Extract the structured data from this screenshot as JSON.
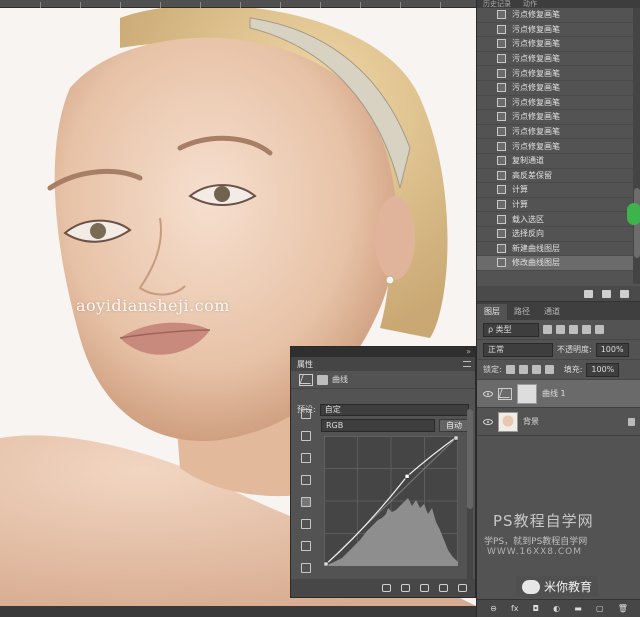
{
  "top_tabs": [
    "历史记录",
    "动作"
  ],
  "history_items": [
    "污点修复画笔",
    "污点修复画笔",
    "污点修复画笔",
    "污点修复画笔",
    "污点修复画笔",
    "污点修复画笔",
    "污点修复画笔",
    "污点修复画笔",
    "污点修复画笔",
    "污点修复画笔",
    "复制通道",
    "高反差保留",
    "计算",
    "计算",
    "载入选区",
    "选择反向",
    "新建曲线图层",
    "修改曲线图层"
  ],
  "canvas_watermark": "aoyidiansheji.com",
  "layers": {
    "tabs": [
      "图层",
      "路径",
      "通道"
    ],
    "filter_label": "类型",
    "blend_mode": "正常",
    "opacity_label": "不透明度:",
    "opacity_value": "100%",
    "lock_label": "锁定:",
    "fill_label": "填充:",
    "fill_value": "100%",
    "items": [
      {
        "name": "曲线 1"
      },
      {
        "name": "背景"
      }
    ],
    "footer": [
      "fx",
      "◘",
      "◐",
      "▬",
      "▢",
      "🗑"
    ]
  },
  "properties": {
    "title": "属性",
    "close": "»",
    "adjustment_name": "曲线",
    "preset_label": "预设:",
    "preset_value": "自定",
    "channel_value": "RGB",
    "auto_button": "自动",
    "curve_points": [
      [
        0,
        0
      ],
      [
        0.62,
        0.69
      ],
      [
        1,
        1
      ]
    ]
  },
  "branding": {
    "line1": "PS教程自学网",
    "line2": "学PS，就到PS教程自学网",
    "line3": "WWW.16XX8.COM",
    "account": "米你教育"
  }
}
